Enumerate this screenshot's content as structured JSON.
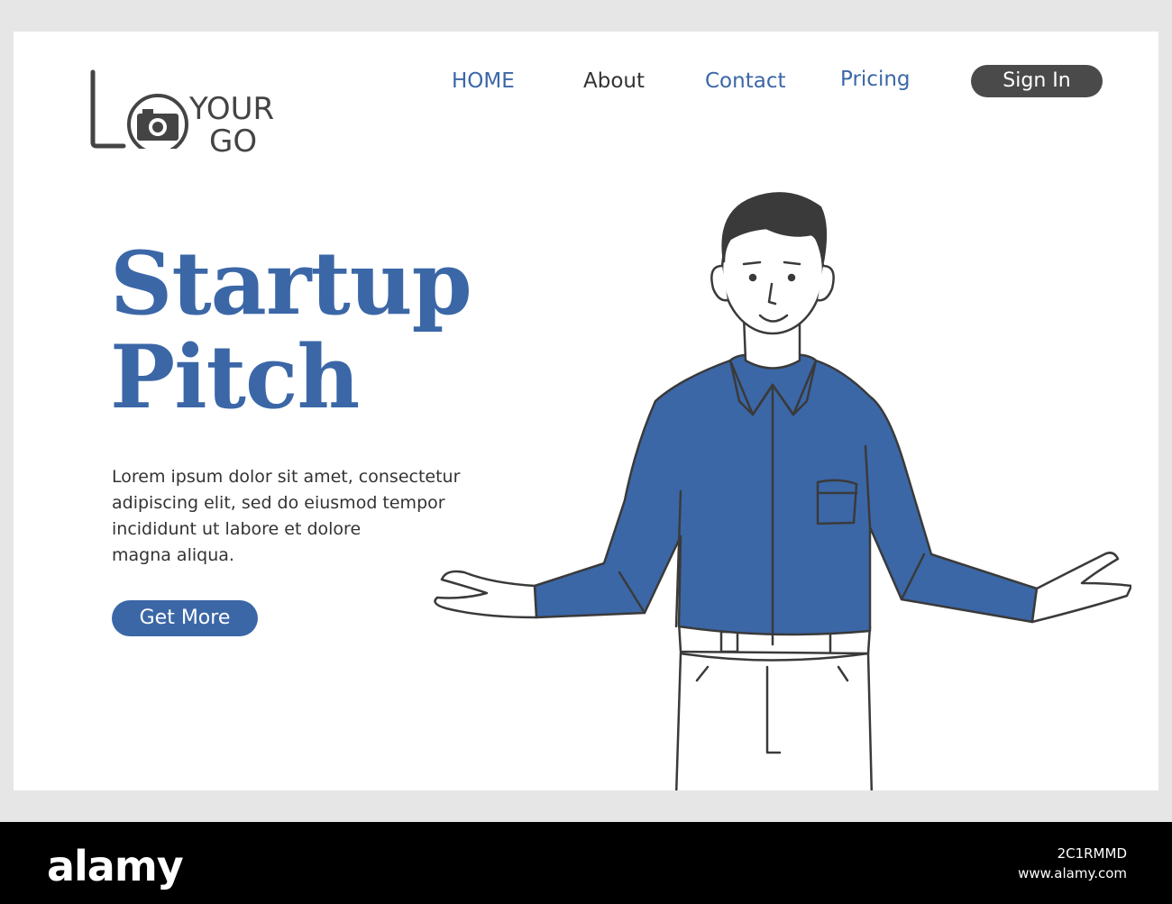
{
  "logo": {
    "word_top": "YOUR",
    "word_bottom": "GO"
  },
  "nav": [
    {
      "label": "HOME",
      "color": "#3b67a7"
    },
    {
      "label": "About",
      "color": "#333333"
    },
    {
      "label": "Contact",
      "color": "#3b67a7"
    },
    {
      "label": "Pricing",
      "color": "#3b67a7"
    }
  ],
  "sign_in": {
    "label": "Sign In"
  },
  "hero": {
    "title_line1": "Startup",
    "title_line2": "Pitch",
    "description_lines": [
      "Lorem ipsum dolor sit amet, consectetur",
      "adipiscing elit, sed do eiusmod tempor",
      "incididunt ut labore et dolore",
      "magna aliqua."
    ],
    "cta_label": "Get More"
  },
  "footer": {
    "brand": "alamy",
    "image_id": "2C1RMMD",
    "url": "www.alamy.com"
  },
  "colors": {
    "accent": "#3b67a7",
    "dark": "#4a4a4a",
    "background": "#e6e6e6"
  },
  "icons": {
    "logo_icon": "camera-icon"
  }
}
